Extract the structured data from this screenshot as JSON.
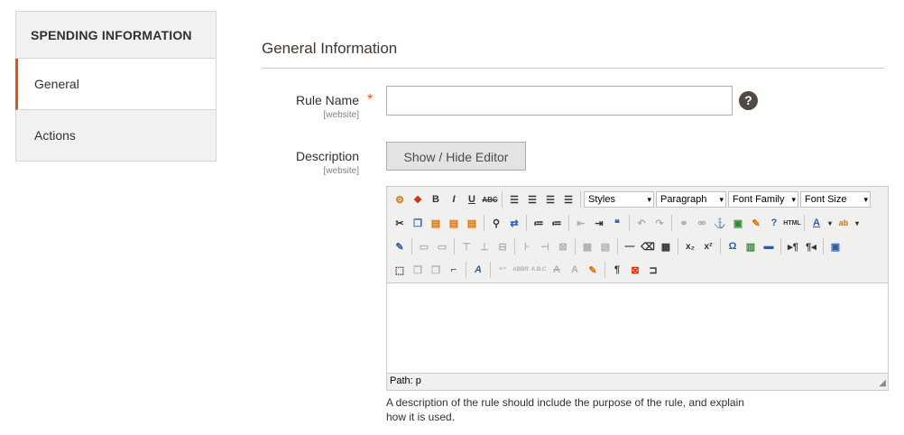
{
  "sidebar": {
    "title": "SPENDING INFORMATION",
    "items": [
      {
        "label": "General"
      },
      {
        "label": "Actions"
      }
    ]
  },
  "section": {
    "title": "General Information"
  },
  "fields": {
    "rule_name": {
      "label": "Rule Name",
      "scope": "[website]",
      "value": "",
      "placeholder": "",
      "required_mark": "*"
    },
    "description": {
      "label": "Description",
      "scope": "[website]",
      "toggle_label": "Show / Hide Editor"
    }
  },
  "help_icon": "?",
  "editor": {
    "dropdowns": {
      "styles": "Styles",
      "paragraph": "Paragraph",
      "font_family": "Font Family",
      "font_size": "Font Size"
    },
    "html_label": "HTML",
    "path_label": "Path: p"
  },
  "note": "A description of the rule should include the purpose of the rule, and explain how it is used.",
  "colors": {
    "accent": "#eb5202",
    "help_bg": "#514943"
  }
}
